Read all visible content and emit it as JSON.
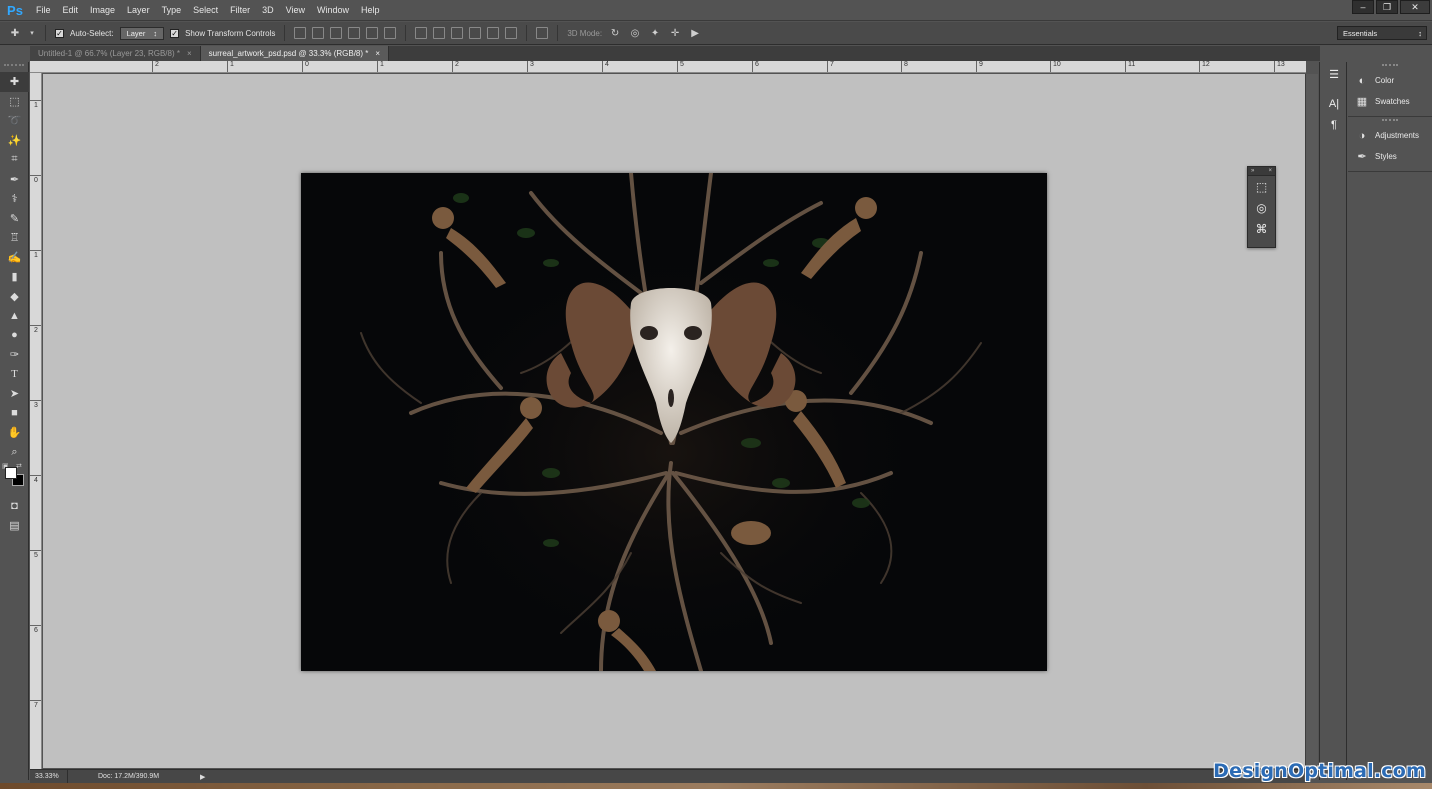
{
  "app": {
    "logo": "Ps"
  },
  "menu": [
    "File",
    "Edit",
    "Image",
    "Layer",
    "Type",
    "Select",
    "Filter",
    "3D",
    "View",
    "Window",
    "Help"
  ],
  "window_controls": {
    "minimize": "–",
    "restore": "❐",
    "close": "✕"
  },
  "options_bar": {
    "auto_select_label": "Auto-Select:",
    "auto_select_checked": true,
    "auto_select_target": "Layer",
    "show_transform_label": "Show Transform Controls",
    "show_transform_checked": true,
    "mode_3d_label": "3D Mode:",
    "workspace": "Essentials"
  },
  "tabs": [
    {
      "label": "Untitled-1 @ 66.7% (Layer 23, RGB/8) *",
      "active": false,
      "close": "×"
    },
    {
      "label": "surreal_artwork_psd.psd @ 33.3% (RGB/8) *",
      "active": true,
      "close": "×"
    }
  ],
  "ruler_top": [
    "2",
    "1",
    "0",
    "1",
    "2",
    "3",
    "4",
    "5",
    "6",
    "7",
    "8",
    "9",
    "10",
    "11",
    "12",
    "13"
  ],
  "ruler_left": [
    "1",
    "0",
    "1",
    "2",
    "3",
    "4",
    "5",
    "6",
    "7"
  ],
  "panels": {
    "group1": [
      "Color",
      "Swatches"
    ],
    "group2": [
      "Adjustments",
      "Styles"
    ]
  },
  "mini_panel": {
    "head_left": "»",
    "head_right": "×"
  },
  "status": {
    "zoom": "33.33%",
    "doc": "Doc: 17.2M/390.9M",
    "arrow": "▶"
  },
  "watermark": "DesignOptimal.com",
  "colors": {
    "foreground": "#ffffff",
    "background": "#000000",
    "canvas_bg": "#c0c0c0",
    "artwork_bg": "#060709"
  }
}
